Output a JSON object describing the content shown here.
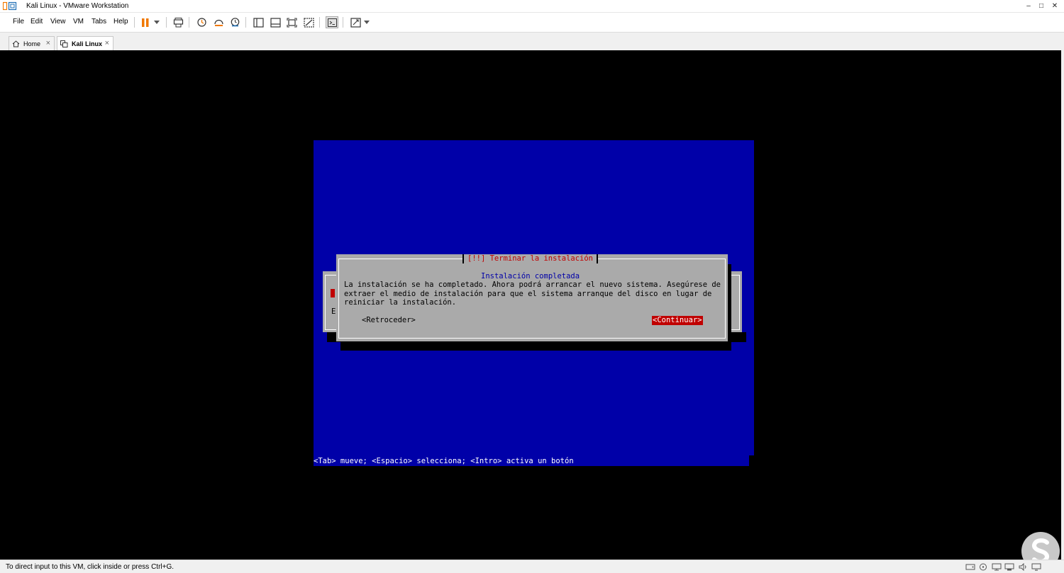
{
  "window": {
    "title": "Kali Linux - VMware Workstation",
    "controls": {
      "minimize": "–",
      "maximize": "□",
      "close": "✕"
    }
  },
  "menu": {
    "items": [
      "File",
      "Edit",
      "View",
      "VM",
      "Tabs",
      "Help"
    ]
  },
  "toolbar": {
    "icons": [
      "pause-icon",
      "dropdown-arrow-icon",
      "send-ctrl-alt-del-icon",
      "snapshot-icon",
      "revert-snapshot-icon",
      "snapshot-manager-icon",
      "show-library-icon",
      "thumbnail-bar-icon",
      "full-screen-icon",
      "unity-icon",
      "console-view-icon",
      "stretch-guest-icon",
      "dropdown-arrow-icon"
    ],
    "accent_color": "#f07800"
  },
  "tabs": [
    {
      "label": "Home",
      "icon": "home-icon",
      "active": false
    },
    {
      "label": "Kali Linux",
      "icon": "vm-icon",
      "active": true
    }
  ],
  "installer": {
    "background_color": "#0000a8",
    "dialog_title": "[!!] Terminar la instalación",
    "dialog_subtitle": "Instalación completada",
    "dialog_body": "La instalación se ha completado. Ahora podrá arrancar el nuevo sistema. Asegúrese de\nextraer el medio de instalación para que el sistema arranque del disco en lugar de\nreiniciar la instalación.",
    "back_button": "<Retroceder>",
    "continue_button": "<Continuar>",
    "background_dialog_letter": "E",
    "help_line": "<Tab> mueve; <Espacio> selecciona; <Intro> activa un botón"
  },
  "status": {
    "message": "To direct input to this VM, click inside or press Ctrl+G.",
    "icons": [
      "hard-disk-icon",
      "cd-dvd-icon",
      "network-adapter-icon",
      "usb-controller-icon",
      "sound-card-icon",
      "display-icon"
    ]
  },
  "watermark": {
    "icon": "watermark-logo-icon",
    "color": "#c8c8c8"
  }
}
